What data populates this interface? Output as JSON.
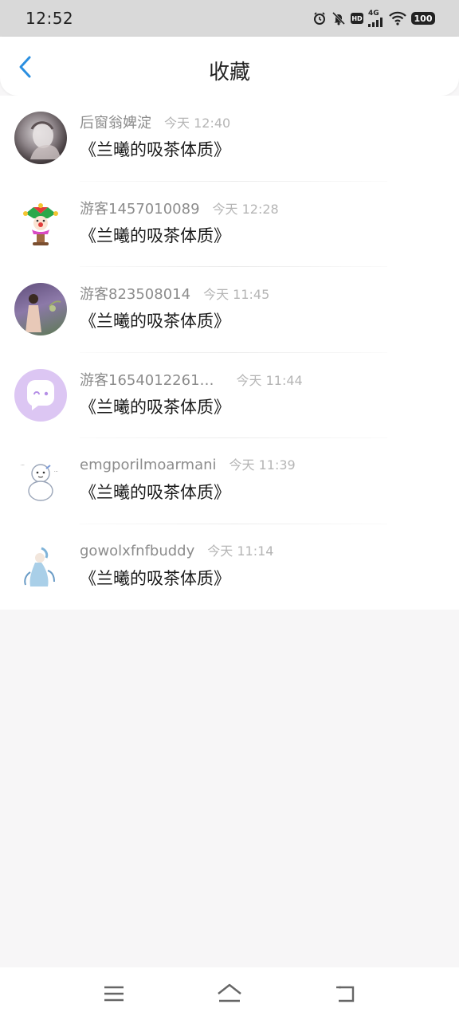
{
  "status_bar": {
    "time": "12:52",
    "network_label": "4G",
    "hd_label": "HD",
    "battery": "100",
    "icons": [
      "alarm-icon",
      "mute-icon",
      "hd-icon",
      "signal-icon",
      "wifi-icon",
      "battery-icon"
    ]
  },
  "header": {
    "title": "收藏",
    "back_icon": "chevron-left-icon",
    "accent_color": "#2b8fe0"
  },
  "favorites": [
    {
      "username": "后窗翁婢淀",
      "time": "今天 12:40",
      "title": "《兰曦的吸茶体质》",
      "avatar": "photo-woman"
    },
    {
      "username": "游客1457010089",
      "time": "今天 12:28",
      "title": "《兰曦的吸茶体质》",
      "avatar": "jester-clown"
    },
    {
      "username": "游客823508014",
      "time": "今天 11:45",
      "title": "《兰曦的吸茶体质》",
      "avatar": "photo-lavender-field"
    },
    {
      "username": "游客1654012261…",
      "time": "今天 11:44",
      "title": "《兰曦的吸茶体质》",
      "avatar": "chat-bubble-purple"
    },
    {
      "username": "emgporilmoarmani",
      "time": "今天 11:39",
      "title": "《兰曦的吸茶体质》",
      "avatar": "cartoon-snowman"
    },
    {
      "username": "gowolxfnfbuddy",
      "time": "今天 11:14",
      "title": "《兰曦的吸茶体质》",
      "avatar": "anime-blue-figure"
    }
  ],
  "nav_bar": {
    "icons": [
      "menu-icon",
      "home-icon",
      "back-icon"
    ]
  }
}
